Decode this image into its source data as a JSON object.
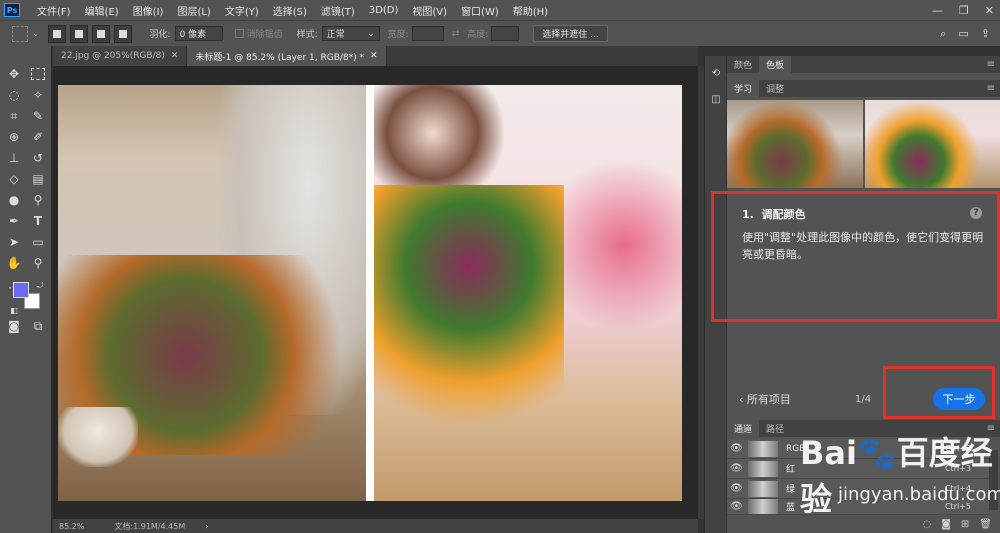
{
  "app": {
    "logo": "Ps"
  },
  "menu": [
    "文件(F)",
    "编辑(E)",
    "图像(I)",
    "图层(L)",
    "文字(Y)",
    "选择(S)",
    "滤镜(T)",
    "3D(D)",
    "视图(V)",
    "窗口(W)",
    "帮助(H)"
  ],
  "window_controls": {
    "minimize": "—",
    "restore": "❐",
    "close": "✕"
  },
  "options": {
    "feather_label": "羽化:",
    "feather_value": "0 像素",
    "antialias_label": "消除锯齿",
    "style_label": "样式:",
    "style_value": "正常",
    "width_label": "宽度:",
    "height_label": "高度:",
    "select_mask_button": "选择并遮住 ..."
  },
  "doc_tabs": [
    {
      "label": "22.jpg @ 205%(RGB/8)",
      "close": "✕"
    },
    {
      "label": "未标题-1 @ 85.2% (Layer 1, RGB/8*) *",
      "close": "✕"
    }
  ],
  "status": {
    "zoom": "85.2%",
    "doc_info": "文档:1.91M/4.45M",
    "arrow": "›"
  },
  "panel_top_tabs": [
    "颜色",
    "色板"
  ],
  "learn_tabs": [
    "学习",
    "调整"
  ],
  "learn": {
    "step_number": "1.",
    "step_title": "调配颜色",
    "help": "?",
    "description": "使用\"调整\"处理此图像中的颜色，使它们变得更明亮或更昏暗。",
    "back_label": "‹ 所有项目",
    "page_indicator": "1/4",
    "next_label": "下一步"
  },
  "channel_tabs": [
    "通道",
    "路径"
  ],
  "channels": [
    {
      "name": "RGB",
      "shortcut": "Ctrl+2"
    },
    {
      "name": "红",
      "shortcut": "Ctrl+3"
    },
    {
      "name": "绿",
      "shortcut": "Ctrl+4"
    },
    {
      "name": "蓝",
      "shortcut": "Ctrl+5"
    }
  ],
  "panel_menu_icon": "≡",
  "watermark": {
    "logo": "Bai🐾百度经验",
    "url": "jingyan.baidu.com"
  },
  "colors": {
    "accent": "#1473e6",
    "highlight": "#e0312d",
    "foreground": "#6b6bf0",
    "background": "#ffffff"
  }
}
